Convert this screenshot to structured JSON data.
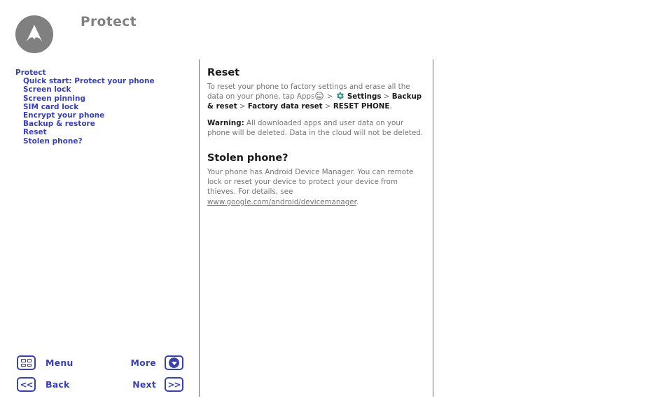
{
  "header": {
    "title": "Protect",
    "logo_icon": "motorola-logo-icon"
  },
  "sidebar": {
    "root_label": "Protect",
    "items": [
      {
        "label": "Quick start: Protect your phone"
      },
      {
        "label": "Screen lock"
      },
      {
        "label": "Screen pinning"
      },
      {
        "label": "SIM card lock"
      },
      {
        "label": "Encrypt your phone"
      },
      {
        "label": "Backup & restore"
      },
      {
        "label": "Reset"
      },
      {
        "label": "Stolen phone?"
      }
    ]
  },
  "content": {
    "reset": {
      "title": "Reset",
      "paragraph_1_part_1": "To reset your phone to factory settings and erase all the data on your phone, tap Apps",
      "paragraph_1_sep_1": ">",
      "paragraph_1_settings": "Settings",
      "paragraph_1_sep_2": ">",
      "paragraph_1_backup": "Backup & reset",
      "paragraph_1_sep_3": ">",
      "paragraph_1_factory": "Factory data reset",
      "paragraph_1_sep_4": ">",
      "paragraph_1_reset_phone": "RESET PHONE",
      "paragraph_1_period": ".",
      "warning_label": "Warning:",
      "warning_text": "All downloaded apps and user data on your phone will be deleted. Data in the cloud will not be deleted.",
      "apps_icon": "apps-grid-icon",
      "settings_icon": "settings-gear-icon"
    },
    "stolen": {
      "title": "Stolen phone?",
      "paragraph_part_1": "Your phone has Android Device Manager. You can remote lock or reset your device to protect your device from thieves. For details, see",
      "link_text": "www.google.com/android/devicemanager",
      "paragraph_end": "."
    }
  },
  "bottom_nav": {
    "menu_label": "Menu",
    "menu_icon": "menu-grid-icon",
    "back_label": "Back",
    "back_icon": "previous-double-chevron-icon",
    "back_glyph": "<<",
    "more_label": "More",
    "more_icon": "more-circle-down-icon",
    "next_label": "Next",
    "next_icon": "next-double-chevron-icon",
    "next_glyph": ">>"
  },
  "colors": {
    "accent_blue": "#3a41a8",
    "title_gray": "#808080",
    "body_gray": "#75757a",
    "heading_black": "#1a1a1a",
    "divider_gray": "#6e6e73",
    "gear_teal": "#3f8f8f"
  }
}
